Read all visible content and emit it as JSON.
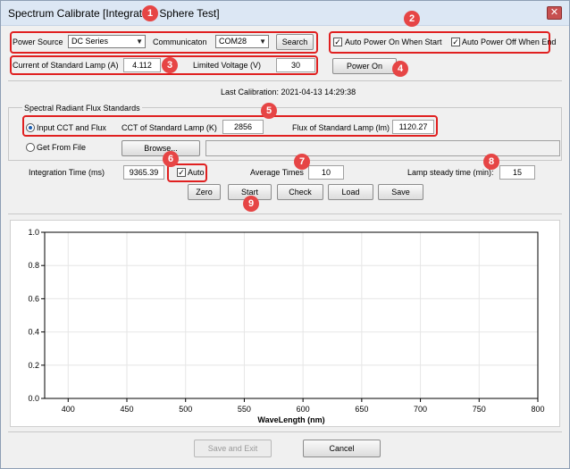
{
  "window": {
    "title": "Spectrum Calibrate [Integration Sphere Test]",
    "close_glyph": "✕"
  },
  "power": {
    "source_label": "Power Source",
    "source_value": "DC Series",
    "comm_label": "Communicaton",
    "comm_value": "COM28",
    "search_label": "Search",
    "auto_on_label": "Auto Power On When Start",
    "auto_off_label": "Auto Power Off When End",
    "auto_on_checked": true,
    "auto_off_checked": true
  },
  "lamp": {
    "current_label": "Current of Standard Lamp (A)",
    "current_value": "4.112",
    "voltage_label": "Limited Voltage (V)",
    "voltage_value": "30",
    "power_on_label": "Power On"
  },
  "last_calibration": "Last Calibration: 2021-04-13 14:29:38",
  "standards": {
    "group_label": "Spectral Radiant Flux Standards",
    "input_label": "Input CCT and Flux",
    "cct_label": "CCT of Standard Lamp (K)",
    "cct_value": "2856",
    "flux_label": "Flux of Standard Lamp (lm)",
    "flux_value": "1120.27",
    "file_label": "Get From File",
    "browse_label": "Browse...",
    "file_path": "",
    "selected": "input"
  },
  "integration": {
    "time_label": "Integration Time (ms)",
    "time_value": "9365.39",
    "auto_label": "Auto",
    "auto_checked": true,
    "avg_label": "Average Times",
    "avg_value": "10",
    "steady_label": "Lamp steady time (min):",
    "steady_value": "15"
  },
  "actions": {
    "zero": "Zero",
    "start": "Start",
    "check": "Check",
    "load": "Load",
    "save": "Save"
  },
  "badges": [
    "1",
    "2",
    "3",
    "4",
    "5",
    "6",
    "7",
    "8",
    "9"
  ],
  "chart_data": {
    "type": "line",
    "title": "",
    "xlabel": "WaveLength (nm)",
    "ylabel": "",
    "xlim": [
      380,
      800
    ],
    "ylim": [
      0.0,
      1.0
    ],
    "x_ticks": [
      "400",
      "450",
      "500",
      "550",
      "600",
      "650",
      "700",
      "750",
      "800"
    ],
    "y_ticks": [
      "0.0",
      "0.2",
      "0.4",
      "0.6",
      "0.8",
      "1.0"
    ],
    "grid": true,
    "series": []
  },
  "footer": {
    "save_exit": "Save and Exit",
    "cancel": "Cancel"
  },
  "colors": {
    "highlight": "#e02020",
    "badge": "#e64545"
  }
}
